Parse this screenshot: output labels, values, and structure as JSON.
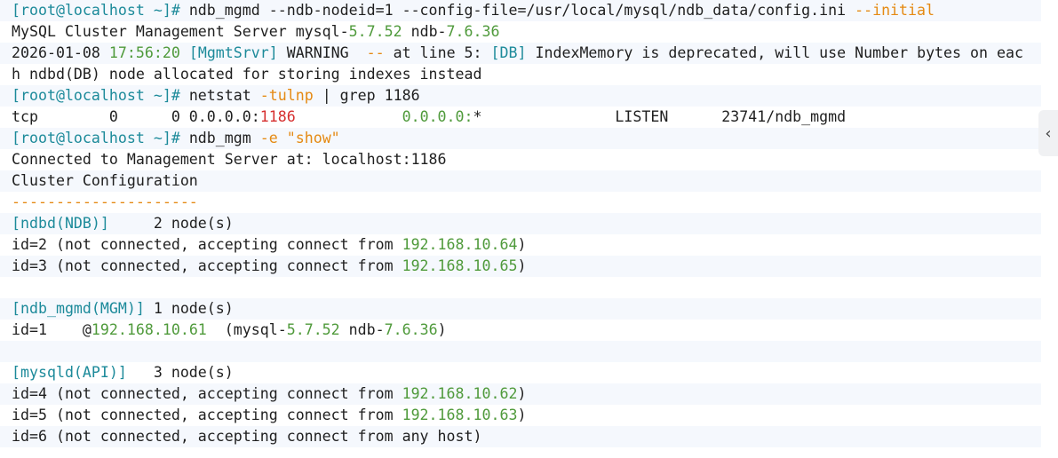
{
  "terminal": {
    "lines": [
      {
        "segs": [
          {
            "t": "[root@localhost ~]# ",
            "c": "cyan"
          },
          {
            "t": "ndb_mgmd --ndb-nodeid=1 --config-file=/usr/local/mysql/ndb_data/config.ini ",
            "c": ""
          },
          {
            "t": "--initial",
            "c": "orange"
          }
        ]
      },
      {
        "segs": [
          {
            "t": "MySQL Cluster Management Server mysql-",
            "c": ""
          },
          {
            "t": "5.7.52",
            "c": "green"
          },
          {
            "t": " ndb-",
            "c": ""
          },
          {
            "t": "7.6.36",
            "c": "green"
          }
        ]
      },
      {
        "segs": [
          {
            "t": "2026-01-08 ",
            "c": ""
          },
          {
            "t": "17:56:20",
            "c": "green"
          },
          {
            "t": " [MgmtSrvr] ",
            "c": "cyan"
          },
          {
            "t": "WARNING  ",
            "c": ""
          },
          {
            "t": "--",
            "c": "orange"
          },
          {
            "t": " at line 5: ",
            "c": ""
          },
          {
            "t": "[DB]",
            "c": "cyan"
          },
          {
            "t": " IndexMemory is deprecated, will use Number bytes on eac",
            "c": ""
          }
        ]
      },
      {
        "segs": [
          {
            "t": "h ndbd(DB) node allocated for storing indexes instead",
            "c": ""
          }
        ]
      },
      {
        "segs": [
          {
            "t": "[root@localhost ~]# ",
            "c": "cyan"
          },
          {
            "t": "netstat ",
            "c": ""
          },
          {
            "t": "-tulnp",
            "c": "orange"
          },
          {
            "t": " | grep 1186",
            "c": ""
          }
        ]
      },
      {
        "segs": [
          {
            "t": "tcp        0      0 0.0.0.0:",
            "c": ""
          },
          {
            "t": "1186",
            "c": "red"
          },
          {
            "t": "            ",
            "c": ""
          },
          {
            "t": "0.0.0.0:",
            "c": "green"
          },
          {
            "t": "*               LISTEN      23741/ndb_mgmd",
            "c": ""
          }
        ]
      },
      {
        "segs": [
          {
            "t": "[root@localhost ~]# ",
            "c": "cyan"
          },
          {
            "t": "ndb_mgm ",
            "c": ""
          },
          {
            "t": "-e",
            "c": "orange"
          },
          {
            "t": " ",
            "c": ""
          },
          {
            "t": "\"show\"",
            "c": "orange"
          }
        ]
      },
      {
        "segs": [
          {
            "t": "Connected to Management Server at: localhost:1186",
            "c": ""
          }
        ]
      },
      {
        "segs": [
          {
            "t": "Cluster Configuration",
            "c": ""
          }
        ]
      },
      {
        "segs": [
          {
            "t": "---------------------",
            "c": "orange"
          }
        ]
      },
      {
        "segs": [
          {
            "t": "[ndbd(NDB)]",
            "c": "cyan"
          },
          {
            "t": "     2 node(s)",
            "c": ""
          }
        ]
      },
      {
        "segs": [
          {
            "t": "id=2 (not connected, accepting connect from ",
            "c": ""
          },
          {
            "t": "192.168.10.64",
            "c": "green"
          },
          {
            "t": ")",
            "c": ""
          }
        ]
      },
      {
        "segs": [
          {
            "t": "id=3 (not connected, accepting connect from ",
            "c": ""
          },
          {
            "t": "192.168.10.65",
            "c": "green"
          },
          {
            "t": ")",
            "c": ""
          }
        ]
      },
      {
        "segs": [
          {
            "t": "",
            "c": ""
          }
        ]
      },
      {
        "segs": [
          {
            "t": "[ndb_mgmd(MGM)]",
            "c": "cyan"
          },
          {
            "t": " 1 node(s)",
            "c": ""
          }
        ]
      },
      {
        "segs": [
          {
            "t": "id=1    @",
            "c": ""
          },
          {
            "t": "192.168.10.61",
            "c": "green"
          },
          {
            "t": "  (mysql-",
            "c": ""
          },
          {
            "t": "5.7.52",
            "c": "green"
          },
          {
            "t": " ndb-",
            "c": ""
          },
          {
            "t": "7.6.36",
            "c": "green"
          },
          {
            "t": ")",
            "c": ""
          }
        ]
      },
      {
        "segs": [
          {
            "t": "",
            "c": ""
          }
        ]
      },
      {
        "segs": [
          {
            "t": "[mysqld(API)]",
            "c": "cyan"
          },
          {
            "t": "   3 node(s)",
            "c": ""
          }
        ]
      },
      {
        "segs": [
          {
            "t": "id=4 (not connected, accepting connect from ",
            "c": ""
          },
          {
            "t": "192.168.10.62",
            "c": "green"
          },
          {
            "t": ")",
            "c": ""
          }
        ]
      },
      {
        "segs": [
          {
            "t": "id=5 (not connected, accepting connect from ",
            "c": ""
          },
          {
            "t": "192.168.10.63",
            "c": "green"
          },
          {
            "t": ")",
            "c": ""
          }
        ]
      },
      {
        "segs": [
          {
            "t": "id=6 (not connected, accepting connect from any host)",
            "c": ""
          }
        ]
      }
    ]
  },
  "scroll_tab": {
    "icon": "chevron-left-icon",
    "glyph": "‹"
  },
  "colors": {
    "cyan": "#1c8a9a",
    "green": "#4f9a3b",
    "orange": "#e58a13",
    "red": "#d62f2f",
    "alt_row": "#f5f8fd"
  }
}
